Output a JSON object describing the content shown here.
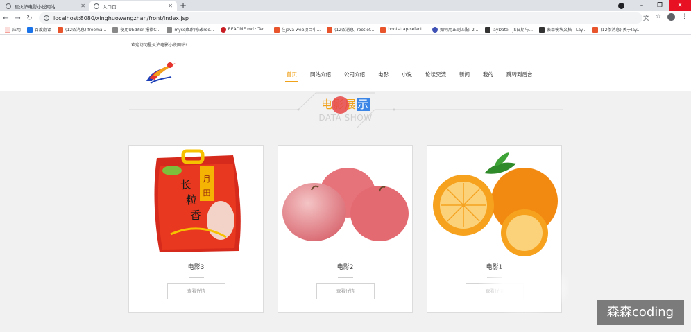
{
  "browser": {
    "tabs": [
      {
        "title": "星火沪电影小说网站",
        "active": false
      },
      {
        "title": "入口页",
        "active": true
      }
    ],
    "url": "localhost:8080/xinghuowangzhan/front/index.jsp",
    "bookmarks": [
      {
        "label": "应用",
        "color": "#ea4335"
      },
      {
        "label": "百度翻译",
        "color": "#1a73e8"
      },
      {
        "label": "(12条消息) freema...",
        "color": "#e8542c"
      },
      {
        "label": "使用UEditor 报错C...",
        "color": "#555555"
      },
      {
        "label": "mysql如何修改roo...",
        "color": "#555555"
      },
      {
        "label": "README.md · Ter...",
        "color": "#c71d23"
      },
      {
        "label": "在java web项目中...",
        "color": "#e8542c"
      },
      {
        "label": "(12条消息) root of...",
        "color": "#e8542c"
      },
      {
        "label": "bootstrap-select...",
        "color": "#e8542c"
      },
      {
        "label": "如何用正则匹配: 2...",
        "color": "#3f51b5"
      },
      {
        "label": "layDate - JS日期与...",
        "color": "#333333"
      },
      {
        "label": "表单模块文档 - Lay...",
        "color": "#333333"
      },
      {
        "label": "(12条消息) 关于lay...",
        "color": "#e8542c"
      }
    ]
  },
  "site": {
    "welcome": "欢迎访问星火沪电影小说网站!",
    "nav": [
      {
        "label": "首页",
        "active": true
      },
      {
        "label": "网站介绍",
        "active": false
      },
      {
        "label": "公司介绍",
        "active": false
      },
      {
        "label": "电影",
        "active": false
      },
      {
        "label": "小说",
        "active": false
      },
      {
        "label": "论坛交流",
        "active": false
      },
      {
        "label": "新闻",
        "active": false
      },
      {
        "label": "我的",
        "active": false
      },
      {
        "label": "跳转到后台",
        "active": false
      }
    ],
    "section": {
      "title_part1": "电影",
      "title_part2": "展",
      "title_part3": "示",
      "subtitle": "DATA SHOW"
    },
    "cards": [
      {
        "caption": "电影3",
        "button": "查看详情",
        "image": "rice-bag"
      },
      {
        "caption": "电影2",
        "button": "查看详情",
        "image": "apples"
      },
      {
        "caption": "电影1",
        "button": "查看详情",
        "image": "oranges"
      }
    ]
  },
  "watermark": "森森coding",
  "colors": {
    "accent": "#f0a21b",
    "highlight": "#3a85e6"
  }
}
